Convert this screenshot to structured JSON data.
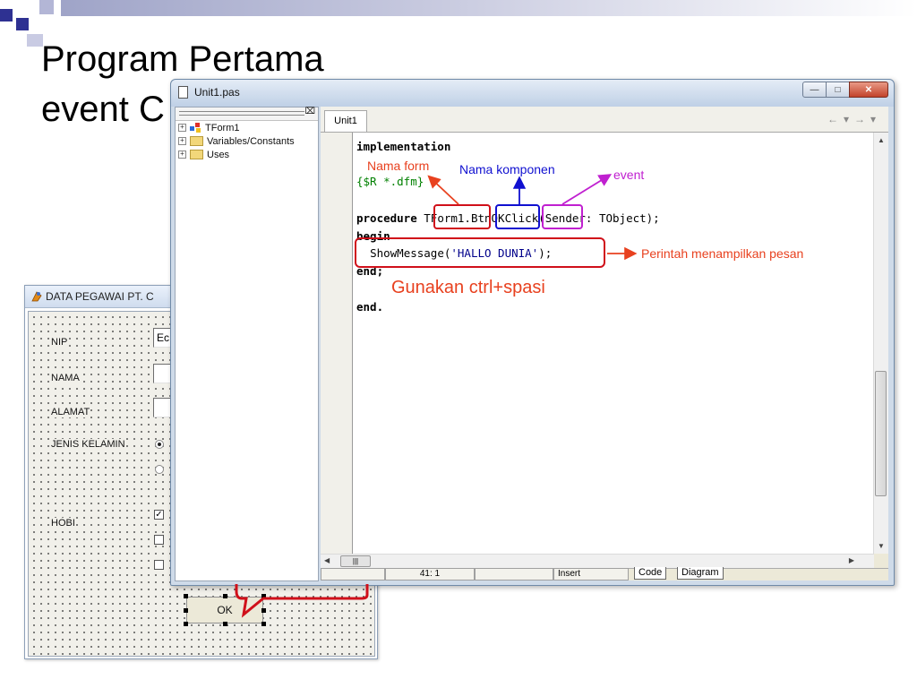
{
  "slide": {
    "title_line1": "Program Pertama",
    "title_line2": "event C"
  },
  "form_window": {
    "title": "DATA PEGAWAI PT. C",
    "labels": {
      "nip": "NIP",
      "nama": "NAMA",
      "alamat": "ALAMAT",
      "jenis_kelamin": "JENIS KELAMIN",
      "hobi": "HOBI"
    },
    "nip_value": "Ec",
    "ok_button": "OK"
  },
  "code_window": {
    "title": "Unit1.pas",
    "explorer_items": [
      "TForm1",
      "Variables/Constants",
      "Uses"
    ],
    "tab_label": "Unit1",
    "code": {
      "line1": "implementation",
      "line2": "{$R *.dfm}",
      "line3_kw": "procedure",
      "line3_form": "TForm1",
      "line3_dot": ".",
      "line3_comp": "BtnOK",
      "line3_event": "Click",
      "line3_rest": "(Sender: TObject);",
      "line4": "begin",
      "line5_fn": "ShowMessage(",
      "line5_str": "'HALLO DUNIA'",
      "line5_end": ");",
      "line6": "end;",
      "line7": "end."
    },
    "status": {
      "position": "41:  1",
      "mode": "Insert",
      "tab_code": "Code",
      "tab_diagram": "Diagram"
    }
  },
  "annotations": {
    "nama_form": "Nama form",
    "nama_komponen": "Nama komponen",
    "event": "event",
    "perintah": "Perintah menampilkan pesan",
    "gunakan": "Gunakan ctrl+spasi"
  },
  "colors": {
    "annotation_red": "#e8411f",
    "annotation_blue": "#1010d0",
    "annotation_magenta": "#c020d0",
    "box_red": "#d0101a"
  }
}
